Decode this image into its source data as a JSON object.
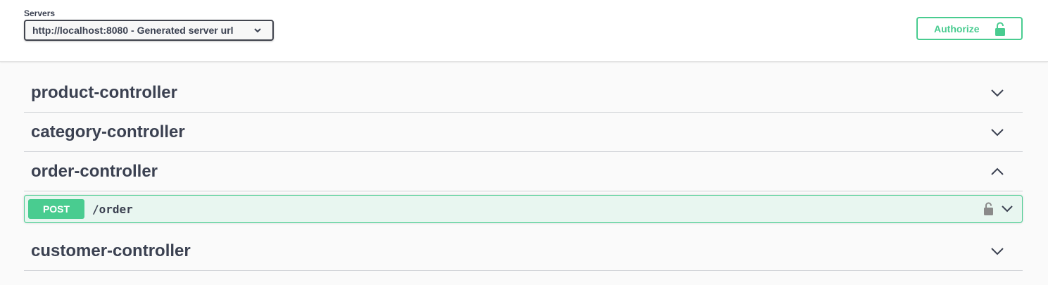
{
  "header": {
    "servers_label": "Servers",
    "server_selected": "http://localhost:8080 - Generated server url",
    "authorize_label": "Authorize"
  },
  "tags": [
    {
      "title": "product-controller",
      "expanded": false
    },
    {
      "title": "category-controller",
      "expanded": false
    },
    {
      "title": "order-controller",
      "expanded": true
    },
    {
      "title": "customer-controller",
      "expanded": false
    }
  ],
  "operation": {
    "method": "POST",
    "path": "/order"
  },
  "colors": {
    "post_green": "#49cc90",
    "post_bg": "#e8f6f0",
    "text": "#3b4151"
  },
  "icons": {
    "server_dropdown": "chevron-down-icon",
    "authorize": "unlock-icon",
    "operation_lock": "unlock-icon",
    "tag_collapsed": "chevron-down-icon",
    "tag_expanded": "chevron-up-icon"
  }
}
